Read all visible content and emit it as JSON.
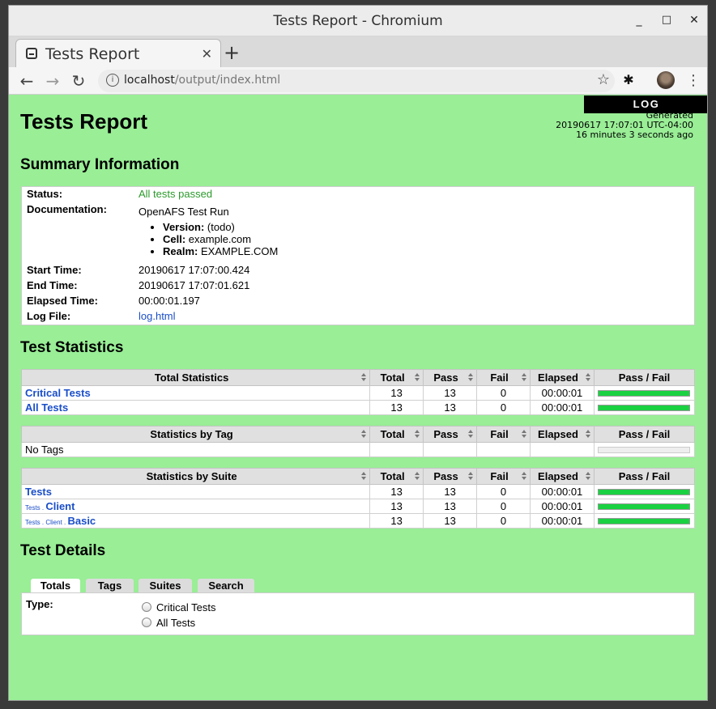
{
  "window": {
    "title": "Tests Report - Chromium",
    "controls": [
      "_",
      "□",
      "✕"
    ]
  },
  "browser": {
    "tab_title": "Tests Report",
    "tab_close": "✕",
    "new_tab": "+",
    "url_host": "localhost",
    "url_path": "/output/index.html",
    "icons": [
      "back-icon",
      "forward-icon",
      "reload-icon",
      "info-icon",
      "star-icon",
      "extension-icon",
      "avatar",
      "menu-icon"
    ]
  },
  "page": {
    "log_link": "LOG",
    "generated_label": "Generated",
    "generated_time": "20190617 17:07:01 UTC-04:00",
    "generated_ago": "16 minutes 3 seconds ago",
    "title": "Tests Report",
    "colors": {
      "background": "#99ee96",
      "pass_bar": "#1ad142",
      "link": "#1a4ec8"
    }
  },
  "summary": {
    "heading": "Summary Information",
    "status_label": "Status:",
    "status_value": "All tests passed",
    "doc_label": "Documentation:",
    "doc_value": "OpenAFS Test Run",
    "doc_items": [
      {
        "key": "Version:",
        "value": "(todo)"
      },
      {
        "key": "Cell:",
        "value": "example.com"
      },
      {
        "key": "Realm:",
        "value": "EXAMPLE.COM"
      }
    ],
    "start_label": "Start Time:",
    "start_value": "20190617 17:07:00.424",
    "end_label": "End Time:",
    "end_value": "20190617 17:07:01.621",
    "elapsed_label": "Elapsed Time:",
    "elapsed_value": "00:00:01.197",
    "logfile_label": "Log File:",
    "logfile_value": "log.html"
  },
  "statistics": {
    "heading": "Test Statistics",
    "columns": [
      "Total",
      "Pass",
      "Fail",
      "Elapsed",
      "Pass / Fail"
    ],
    "total": {
      "header": "Total Statistics",
      "rows": [
        {
          "name": "Critical Tests",
          "total": "13",
          "pass": "13",
          "fail": "0",
          "elapsed": "00:00:01",
          "pass_ratio": 1.0
        },
        {
          "name": "All Tests",
          "total": "13",
          "pass": "13",
          "fail": "0",
          "elapsed": "00:00:01",
          "pass_ratio": 1.0
        }
      ]
    },
    "tag": {
      "header": "Statistics by Tag",
      "empty": "No Tags"
    },
    "suite": {
      "header": "Statistics by Suite",
      "rows": [
        {
          "parent": "",
          "name": "Tests",
          "total": "13",
          "pass": "13",
          "fail": "0",
          "elapsed": "00:00:01",
          "pass_ratio": 1.0
        },
        {
          "parent": "Tests . ",
          "name": "Client",
          "total": "13",
          "pass": "13",
          "fail": "0",
          "elapsed": "00:00:01",
          "pass_ratio": 1.0
        },
        {
          "parent": "Tests . Client . ",
          "name": "Basic",
          "total": "13",
          "pass": "13",
          "fail": "0",
          "elapsed": "00:00:01",
          "pass_ratio": 1.0
        }
      ]
    }
  },
  "details": {
    "heading": "Test Details",
    "tabs": [
      "Totals",
      "Tags",
      "Suites",
      "Search"
    ],
    "active_tab": "Totals",
    "type_label": "Type:",
    "options": [
      "Critical Tests",
      "All Tests"
    ]
  }
}
